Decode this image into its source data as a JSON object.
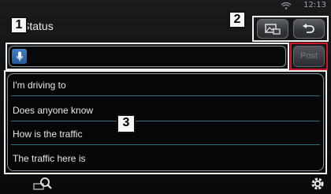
{
  "status_bar": {
    "time": "12:13",
    "wifi_icon": "wifi-icon"
  },
  "header": {
    "title": "Status",
    "buttons": [
      {
        "icon": "photo-share-icon"
      },
      {
        "icon": "back-icon"
      }
    ]
  },
  "compose": {
    "mic_icon": "microphone-icon",
    "value": "",
    "post_label": "Post"
  },
  "phrases": [
    "I'm driving to",
    "Does anyone know",
    "How is the traffic",
    "The traffic here is"
  ],
  "callouts": {
    "c1": "1",
    "c2": "2",
    "c3": "3"
  },
  "bottom_bar": {
    "left_icon": "search-history-icon",
    "right_icon": "settings-icon"
  },
  "colors": {
    "accent_red": "#d0182a",
    "mic_blue": "#3f7fc8",
    "divider": "#2f6f86"
  }
}
